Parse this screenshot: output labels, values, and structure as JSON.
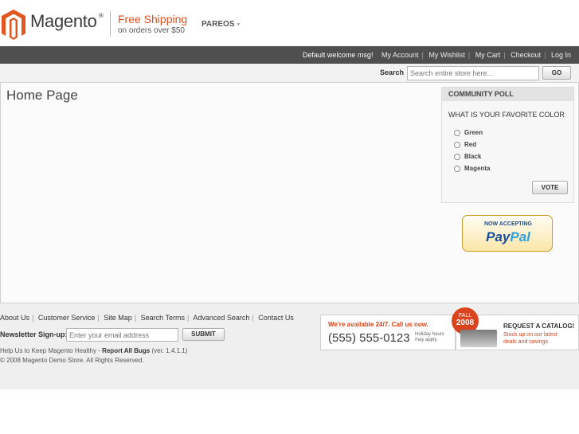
{
  "header": {
    "logo_text": "Magento",
    "logo_reg": "®",
    "free_shipping": "Free Shipping",
    "free_shipping_sub": "on orders over $50",
    "store_switcher": "PAREOS",
    "store_switcher_arrow": "▾"
  },
  "toplinks": {
    "welcome": "Default welcome msg!",
    "links": [
      "My Account",
      "My Wishlist",
      "My Cart",
      "Checkout",
      "Log In"
    ]
  },
  "search": {
    "label": "Search",
    "placeholder": "Search entire store here...",
    "button": "GO"
  },
  "main": {
    "title": "Home Page"
  },
  "poll": {
    "heading": "COMMUNITY POLL",
    "question": "WHAT IS YOUR FAVORITE COLOR",
    "options": [
      "Green",
      "Red",
      "Black",
      "Magenta"
    ],
    "vote_button": "VOTE"
  },
  "paypal": {
    "now_accepting": "NOW ACCEPTING",
    "pay": "Pay",
    "pal": "Pal"
  },
  "footer": {
    "links": [
      "About Us",
      "Customer Service",
      "Site Map",
      "Search Terms",
      "Advanced Search",
      "Contact Us"
    ],
    "newsletter_label": "Newsletter Sign-up:",
    "newsletter_placeholder": "Enter your email address",
    "submit": "SUBMIT",
    "help_prefix": "Help Us to Keep Magento Healthy - ",
    "report_bugs": "Report All Bugs",
    "version": "(ver. 1.4.1.1)",
    "copyright": "© 2008 Magento Demo Store. All Rights Reserved."
  },
  "banner": {
    "available": "We're available 24/7. Call us now.",
    "phone": "(555) 555-0123",
    "holiday_line1": "Holiday hours",
    "holiday_line2": "may apply.",
    "fall": "FALL",
    "year": "2008",
    "request": "REQUEST A CATALOG!",
    "stock_line1": "Stock up on our latest",
    "stock_line2": "deals and savings"
  },
  "colors": {
    "accent": "#df4f1f",
    "topbar": "#4f4f4f",
    "footer_bg": "#efefef"
  }
}
